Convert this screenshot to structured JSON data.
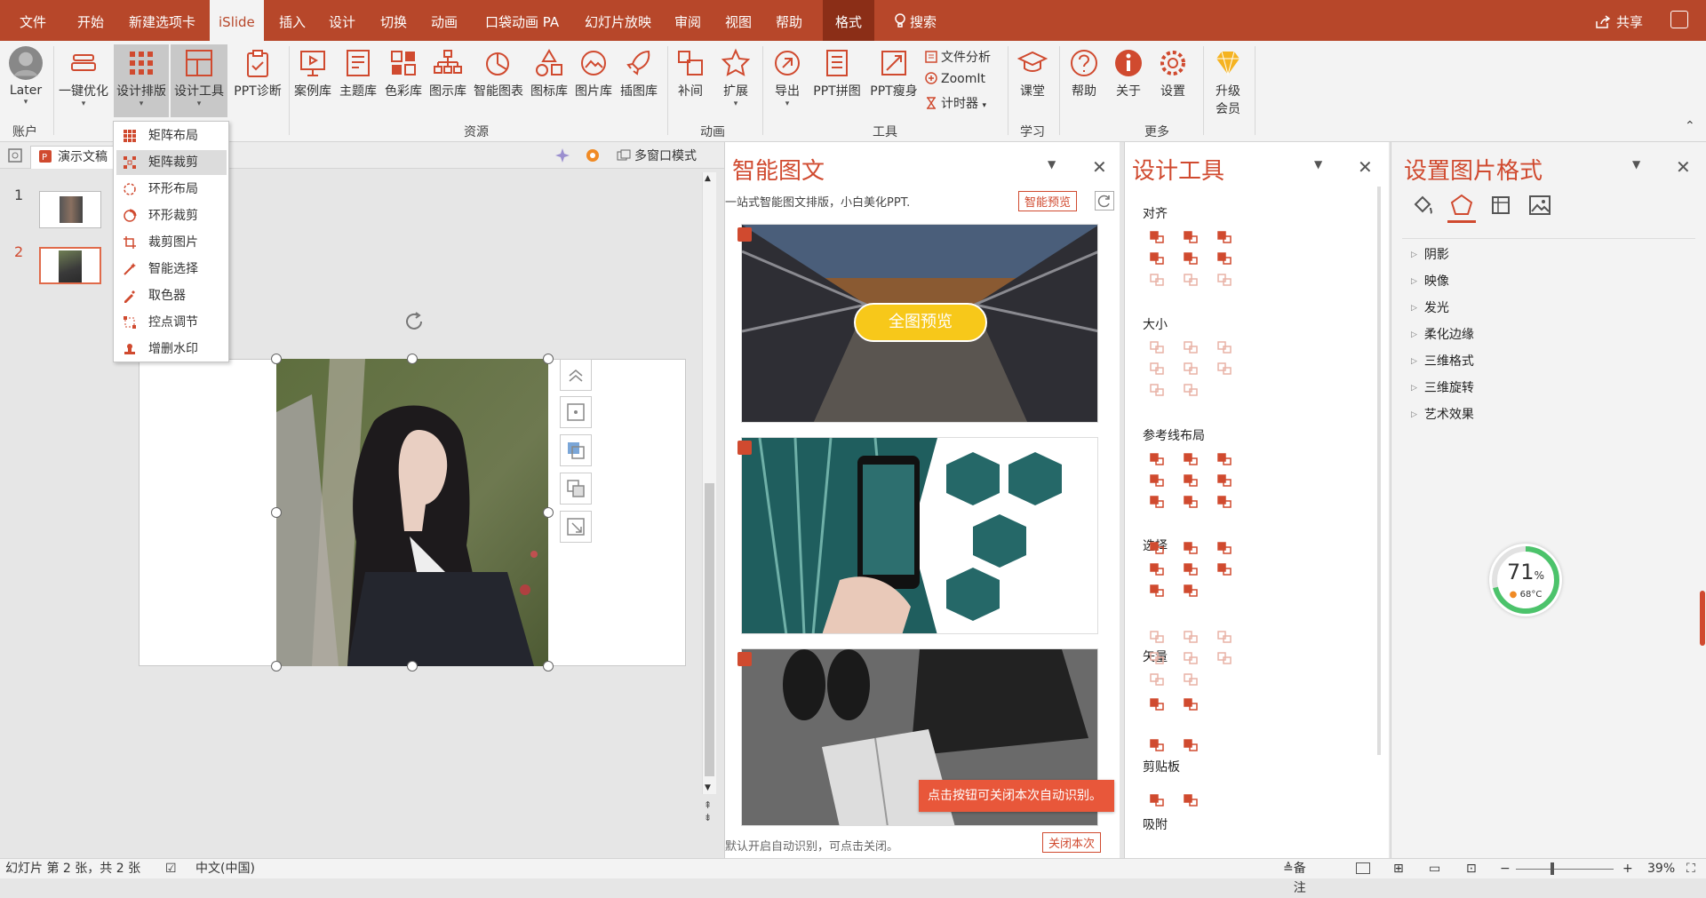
{
  "tabs": [
    "文件",
    "开始",
    "新建选项卡",
    "iSlide",
    "插入",
    "设计",
    "切换",
    "动画",
    "口袋动画 PA",
    "幻灯片放映",
    "审阅",
    "视图",
    "帮助",
    "格式"
  ],
  "search_label": "搜索",
  "share_label": "共享",
  "ribbon": {
    "later": "Later",
    "one_click": "一键优化",
    "design_layout": "设计排版",
    "design_tools": "设计工具",
    "ppt_diag": "PPT诊断",
    "cases": "案例库",
    "themes": "主题库",
    "colors": "色彩库",
    "diagrams": "图示库",
    "smart_charts": "智能图表",
    "icons": "图标库",
    "images": "图片库",
    "illustrations": "插图库",
    "tween": "补间",
    "expand": "扩展",
    "export": "导出",
    "ppt_merge": "PPT拼图",
    "ppt_slim": "PPT瘦身",
    "file_analysis": "文件分析",
    "zoomit": "ZoomIt",
    "timer": "计时器",
    "classroom": "课堂",
    "help": "帮助",
    "about": "关于",
    "settings": "设置",
    "upgrade_1": "升级",
    "upgrade_2": "会员"
  },
  "groups": {
    "account": "账户",
    "resources": "资源",
    "animation": "动画",
    "tools": "工具",
    "learn": "学习",
    "more": "更多"
  },
  "doc_tab": "演示文稿",
  "multi_window": "多窗口模式",
  "menu": [
    "矩阵布局",
    "矩阵裁剪",
    "环形布局",
    "环形裁剪",
    "裁剪图片",
    "智能选择",
    "取色器",
    "控点调节",
    "增删水印"
  ],
  "slides": [
    "1",
    "2"
  ],
  "smart_panel": {
    "title": "智能图文",
    "subtitle": "一站式智能图文排版，小白美化PPT.",
    "preview_btn": "智能预览",
    "full_preview": "全图预览",
    "tip": "点击按钮可关闭本次自动识别。",
    "footer": "默认开启自动识别，可点击关闭。",
    "close_once": "关闭本次"
  },
  "design_panel": {
    "title": "设计工具",
    "sections": [
      "对齐",
      "大小",
      "参考线布局",
      "选择",
      "矢量",
      "剪贴板",
      "吸附"
    ]
  },
  "format_panel": {
    "title": "设置图片格式",
    "items": [
      "阴影",
      "映像",
      "发光",
      "柔化边缘",
      "三维格式",
      "三维旋转",
      "艺术效果"
    ]
  },
  "gauge": {
    "percent": "71",
    "unit": "%",
    "temp": "68°C"
  },
  "status": {
    "slide_info": "幻灯片 第 2 张，共 2 张",
    "language": "中文(中国)",
    "notes": "备注",
    "zoom": "39%"
  },
  "colors": {
    "accent": "#b7472a",
    "panel_title": "#d04a2f"
  }
}
